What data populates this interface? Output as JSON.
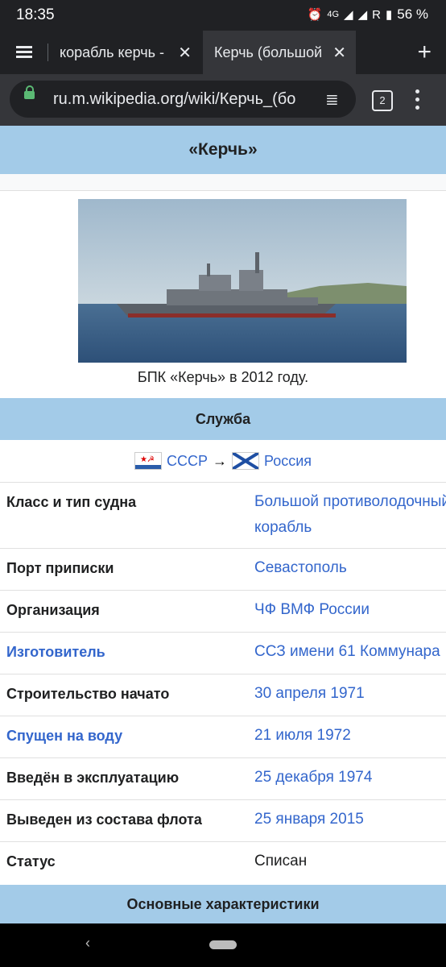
{
  "status": {
    "time": "18:35",
    "network": "4G",
    "carrier": "R",
    "battery": "56 %"
  },
  "tabs": [
    {
      "title": "корабль керчь -"
    },
    {
      "title": "Керчь (большой"
    }
  ],
  "omnibox": {
    "url": "ru.m.wikipedia.org/wiki/Керчь_(бо",
    "tabs_count": "2"
  },
  "article": {
    "title": "«Керчь»",
    "image_caption": "БПК «Керчь» в 2012 году.",
    "service_header": "Служба",
    "flags": {
      "from": "СССР",
      "arrow": "→",
      "to": "Россия"
    },
    "rows": [
      {
        "label": "Класс и тип судна",
        "value": "Большой противолодочный корабль"
      },
      {
        "label": "Порт приписки",
        "value": "Севастополь"
      },
      {
        "label": "Организация",
        "value": "ЧФ ВМФ России"
      },
      {
        "label": "Изготовитель",
        "value": "ССЗ имени 61 Коммунара"
      },
      {
        "label": "Строительство начато",
        "value": "30 апреля 1971"
      },
      {
        "label": "Спущен на воду",
        "value": "21 июля 1972"
      },
      {
        "label": "Введён в эксплуатацию",
        "value": "25 декабря 1974"
      },
      {
        "label": "Выведен из состава флота",
        "value": "25 января 2015"
      },
      {
        "label": "Статус",
        "value": "Списан"
      }
    ],
    "main_header": "Основные характеристики"
  }
}
